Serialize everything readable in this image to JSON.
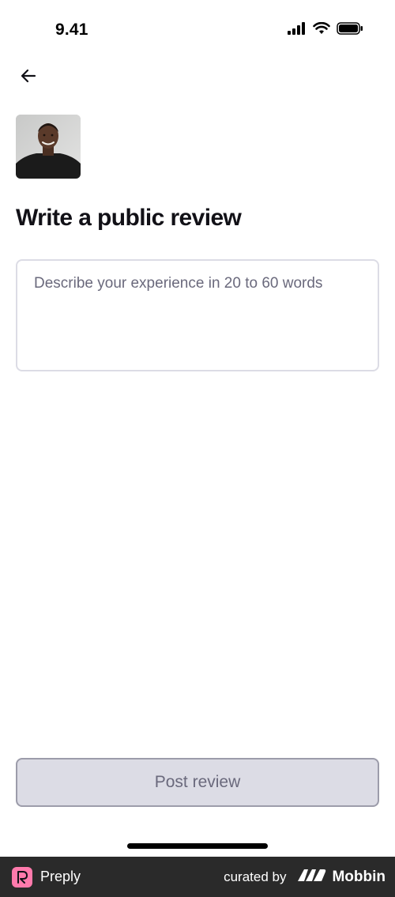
{
  "status_bar": {
    "time": "9.41",
    "icons": [
      "signal-icon",
      "wifi-icon",
      "battery-icon"
    ]
  },
  "header": {
    "back_icon": "arrow-left-icon"
  },
  "tutor": {
    "avatar": "tutor-avatar"
  },
  "page": {
    "title": "Write a public review"
  },
  "review": {
    "value": "",
    "placeholder": "Describe your experience in 20 to 60 words"
  },
  "actions": {
    "post_label": "Post review"
  },
  "footer": {
    "brand": "Preply",
    "curated_by": "curated by",
    "mobbin": "Mobbin"
  },
  "colors": {
    "text": "#121117",
    "placeholder": "#6a697c",
    "border": "#dcdce5",
    "button_disabled_bg": "#dcdce5",
    "preply_pink": "#ff7aac",
    "footer_bg": "#2a2a2a"
  }
}
